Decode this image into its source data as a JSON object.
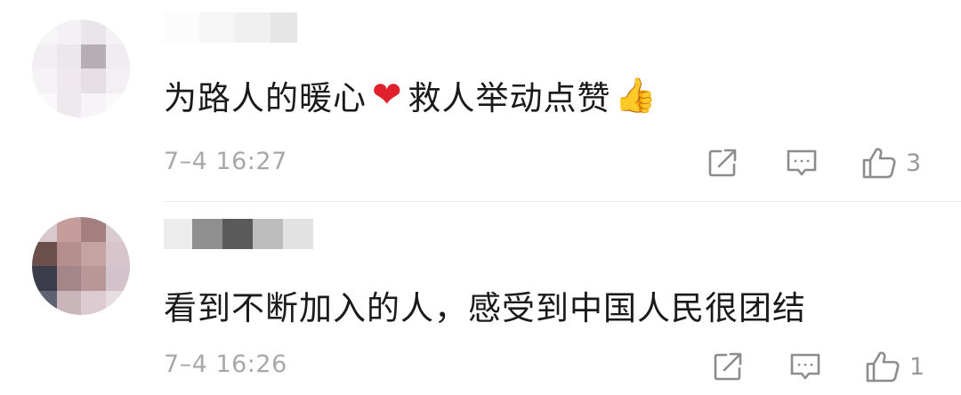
{
  "comments": [
    {
      "text_before": "为路人的暖心",
      "heart_emoji": "❤",
      "text_after": "救人举动点赞",
      "thumbs_emoji": "👍",
      "time": "7–4 16:27",
      "likes": "3"
    },
    {
      "text": "看到不断加入的人，感受到中国人民很团结",
      "time": "7–4 16:26",
      "likes": "1"
    }
  ],
  "icons": {
    "share": "share-icon",
    "reply": "comment-icon",
    "like": "thumbs-up-icon"
  },
  "colors": {
    "text": "#1a1a1a",
    "meta": "#a8a8a8",
    "icon": "#8c8c8c",
    "heart": "#e0202b"
  }
}
